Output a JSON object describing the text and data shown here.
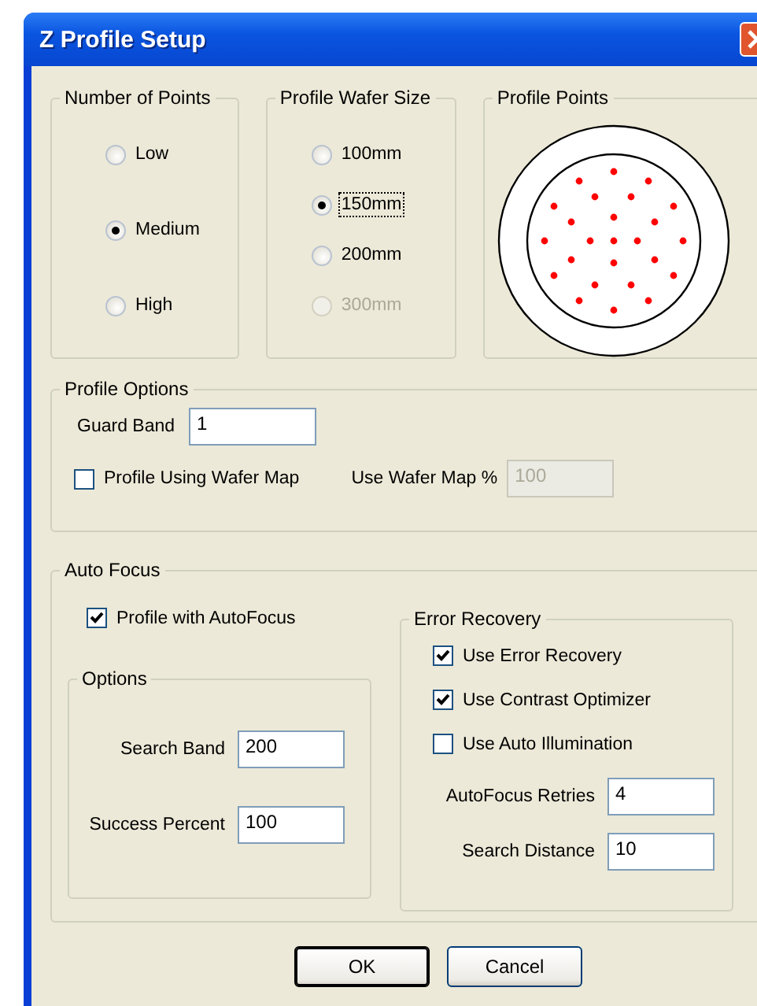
{
  "window": {
    "title": "Z Profile Setup"
  },
  "number_of_points": {
    "title": "Number of Points",
    "options": [
      {
        "label": "Low",
        "selected": false
      },
      {
        "label": "Medium",
        "selected": true
      },
      {
        "label": "High",
        "selected": false
      }
    ]
  },
  "profile_wafer_size": {
    "title": "Profile Wafer Size",
    "options": [
      {
        "label": "100mm",
        "selected": false,
        "disabled": false,
        "focused": false
      },
      {
        "label": "150mm",
        "selected": true,
        "disabled": false,
        "focused": true
      },
      {
        "label": "200mm",
        "selected": false,
        "disabled": false,
        "focused": false
      },
      {
        "label": "300mm",
        "selected": false,
        "disabled": true,
        "focused": false
      }
    ]
  },
  "profile_points": {
    "title": "Profile Points"
  },
  "profile_options": {
    "title": "Profile Options",
    "guard_band": {
      "label": "Guard Band",
      "value": "1"
    },
    "use_wafer_map": {
      "label": "Profile Using Wafer Map",
      "checked": false
    },
    "wafer_map_percent": {
      "label": "Use Wafer Map %",
      "value": "100",
      "disabled": true
    }
  },
  "auto_focus": {
    "title": "Auto Focus",
    "profile_with_autofocus": {
      "label": "Profile with AutoFocus",
      "checked": true
    },
    "options": {
      "title": "Options",
      "fields": [
        {
          "label": "Search Band",
          "value": "200"
        },
        {
          "label": "Success Percent",
          "value": "100"
        }
      ]
    },
    "error_recovery": {
      "title": "Error Recovery",
      "checks": [
        {
          "label": "Use Error Recovery",
          "checked": true
        },
        {
          "label": "Use Contrast Optimizer",
          "checked": true
        },
        {
          "label": "Use Auto Illumination",
          "checked": false
        }
      ],
      "fields": [
        {
          "label": "AutoFocus Retries",
          "value": "4"
        },
        {
          "label": "Search Distance",
          "value": "10"
        }
      ]
    }
  },
  "buttons": [
    {
      "label": "OK",
      "default": true
    },
    {
      "label": "Cancel",
      "default": false
    }
  ]
}
